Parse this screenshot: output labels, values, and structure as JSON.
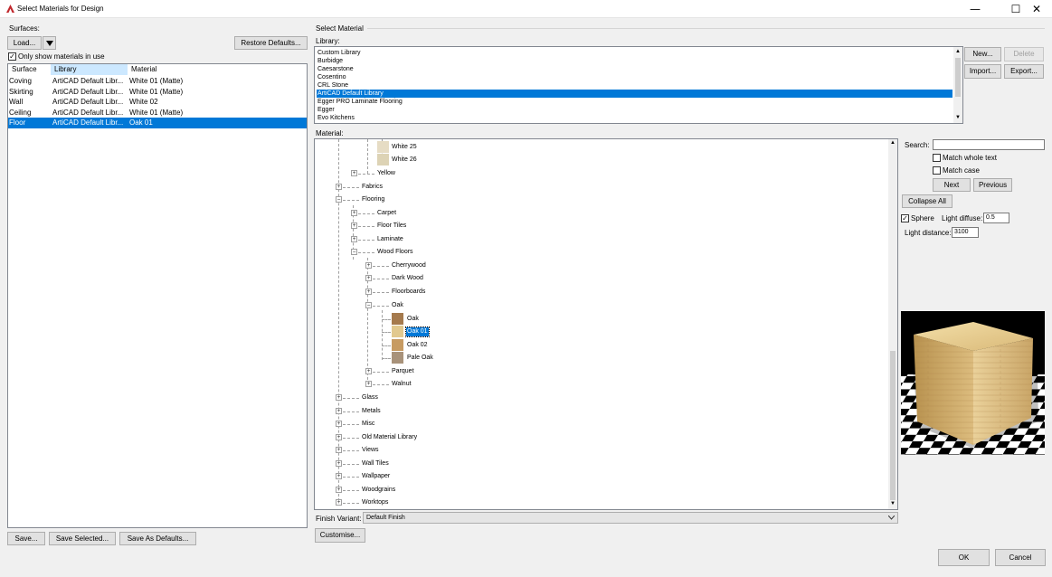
{
  "window": {
    "title": "Select Materials for Design",
    "minimize": "—",
    "maximize": "☐",
    "close": "✕"
  },
  "surfaces": {
    "label": "Surfaces:",
    "load_button": "Load...",
    "restore_button": "Restore Defaults...",
    "only_show_label": "Only show materials in use",
    "only_show_checked": true,
    "columns": [
      "Surface",
      "Library",
      "Material"
    ],
    "rows": [
      {
        "surface": "Coving",
        "library": "ArtiCAD Default Libr...",
        "material": "White 01 (Matte)"
      },
      {
        "surface": "Skirting",
        "library": "ArtiCAD Default Libr...",
        "material": "White 01 (Matte)"
      },
      {
        "surface": "Wall",
        "library": "ArtiCAD Default Libr...",
        "material": "White 02"
      },
      {
        "surface": "Ceiling",
        "library": "ArtiCAD Default Libr...",
        "material": "White 01 (Matte)"
      },
      {
        "surface": "Floor",
        "library": "ArtiCAD Default Libr...",
        "material": "Oak 01"
      }
    ],
    "selected_row": 4,
    "save_button": "Save...",
    "save_selected_button": "Save Selected...",
    "save_defaults_button": "Save As Defaults..."
  },
  "select_material": {
    "group_label": "Select Material",
    "library_label": "Library:",
    "libraries": [
      "Custom Library",
      "Burbidge",
      "Caesarstone",
      "Cosentino",
      "CRL Stone",
      "ArtiCAD Default Library",
      "Egger PRO Laminate Flooring",
      "Egger",
      "Evo Kitchens"
    ],
    "selected_library": 5,
    "new_button": "New...",
    "delete_button": "Delete",
    "import_button": "Import...",
    "export_button": "Export...",
    "material_label": "Material:",
    "tree": {
      "white25": "White 25",
      "white26": "White 26",
      "yellow": "Yellow",
      "fabrics": "Fabrics",
      "flooring": "Flooring",
      "carpet": "Carpet",
      "floor_tiles": "Floor Tiles",
      "laminate": "Laminate",
      "wood_floors": "Wood Floors",
      "cherrywood": "Cherrywood",
      "dark_wood": "Dark Wood",
      "floorboards": "Floorboards",
      "oak_group": "Oak",
      "oak": "Oak",
      "oak01": "Oak 01",
      "oak02": "Oak 02",
      "pale_oak": "Pale Oak",
      "parquet": "Parquet",
      "walnut": "Walnut",
      "glass": "Glass",
      "metals": "Metals",
      "misc": "Misc",
      "old_material_library": "Old Material Library",
      "views": "Views",
      "wall_tiles": "Wall Tiles",
      "wallpaper": "Wallpaper",
      "woodgrains": "Woodgrains",
      "worktops": "Worktops"
    },
    "finish_variant_label": "Finish Variant:",
    "finish_variant_value": "Default Finish",
    "customise_button": "Customise..."
  },
  "search": {
    "label": "Search:",
    "value": "",
    "match_whole_label": "Match whole text",
    "match_case_label": "Match case",
    "next_button": "Next",
    "previous_button": "Previous",
    "collapse_button": "Collapse All"
  },
  "preview": {
    "sphere_label": "Sphere",
    "sphere_checked": true,
    "light_diffuse_label": "Light diffuse:",
    "light_diffuse_value": "0.5",
    "light_distance_label": "Light distance:",
    "light_distance_value": "3100"
  },
  "footer": {
    "ok_button": "OK",
    "cancel_button": "Cancel"
  },
  "colors": {
    "selection": "#0078d7",
    "oak": "#a57a4d",
    "oak01": "#e2c98f",
    "oak02": "#c79b62",
    "pale_oak": "#a8927a",
    "white25": "#e6dcc4",
    "white26": "#ddd3b5"
  }
}
